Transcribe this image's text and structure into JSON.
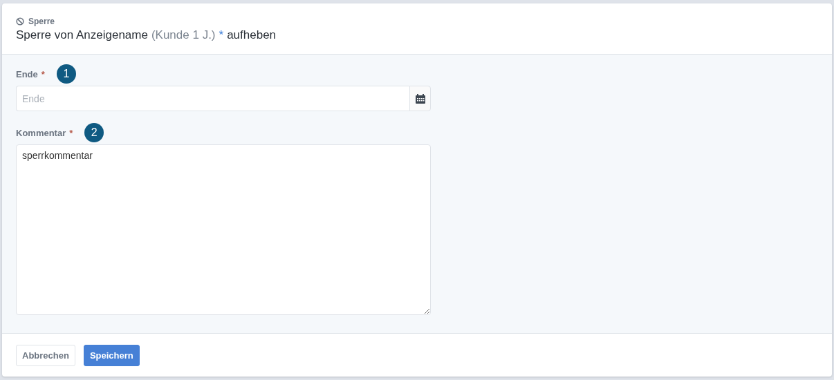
{
  "dialog": {
    "kicker": "Sperre",
    "title": {
      "prefix": "Sperre von Anzeigename",
      "detail": "(Kunde 1 J.)",
      "marker": "*",
      "suffix": "aufheben"
    }
  },
  "fields": [
    {
      "kind": "date",
      "label": "Ende",
      "required_mark": "*",
      "badge": "1",
      "placeholder": "Ende"
    },
    {
      "kind": "textarea",
      "label": "Kommentar",
      "required_mark": "*",
      "badge": "2",
      "value": "sperrkommentar"
    }
  ],
  "buttons": [
    {
      "label": "Abbrechen",
      "kind": "secondary"
    },
    {
      "label": "Speichern",
      "kind": "primary"
    }
  ]
}
